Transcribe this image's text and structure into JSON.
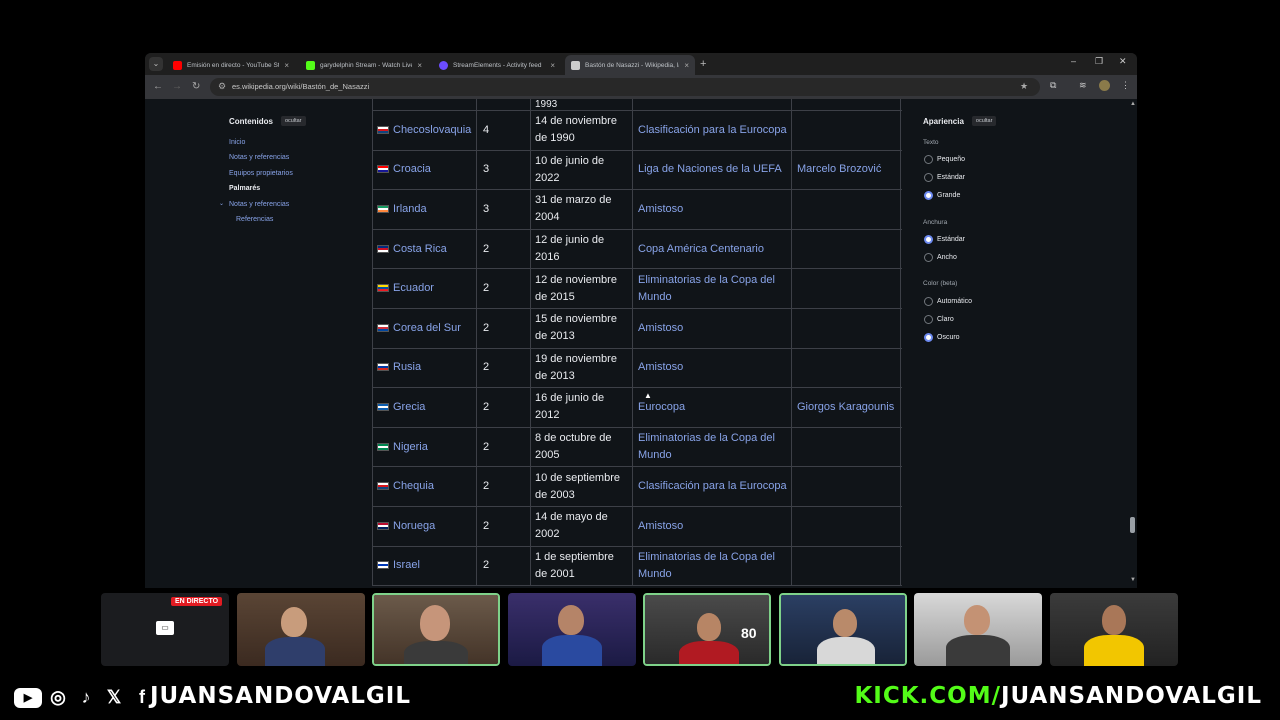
{
  "browser": {
    "tabs": [
      {
        "title": "Emisión en directo - YouTube Stu",
        "color": "#ff0000"
      },
      {
        "title": "garydelphin Stream - Watch Live o",
        "color": "#53fc18"
      },
      {
        "title": "StreamElements - Activity feed",
        "color": "#6b4cff"
      },
      {
        "title": "Bastón de Nasazzi - Wikipedia, la",
        "color": "#cccccc"
      }
    ],
    "new_tab": "+",
    "url": "es.wikipedia.org/wiki/Bastón_de_Nasazzi"
  },
  "toc": {
    "title": "Contenidos",
    "hide": "ocultar",
    "items": [
      "Inicio",
      "Notas y referencias",
      "Equipos propietarios",
      "Palmarés",
      "Notas y referencias",
      "Referencias"
    ]
  },
  "table": {
    "top_fragment": "1993",
    "rows": [
      {
        "country": "Checoslovaquia",
        "count": "4",
        "date": "14 de noviembre de 1990",
        "match": "Clasificación para la Eurocopa",
        "captain": "",
        "flag": [
          "#ffffff",
          "#d7141a",
          "#11457e"
        ]
      },
      {
        "country": "Croacia",
        "count": "3",
        "date": "10 de junio de 2022",
        "match": "Liga de Naciones de la UEFA",
        "captain": "Marcelo Brozović",
        "flag": [
          "#ff0000",
          "#ffffff",
          "#171796"
        ]
      },
      {
        "country": "Irlanda",
        "count": "3",
        "date": "31 de marzo de 2004",
        "match": "Amistoso",
        "captain": "",
        "flag": [
          "#169b62",
          "#ffffff",
          "#ff883e"
        ]
      },
      {
        "country": "Costa Rica",
        "count": "2",
        "date": "12 de junio de 2016",
        "match": "Copa América Centenario",
        "captain": "",
        "flag": [
          "#002b7f",
          "#ce1126",
          "#ffffff"
        ]
      },
      {
        "country": "Ecuador",
        "count": "2",
        "date": "12 de noviembre de 2015",
        "match": "Eliminatorias de la Copa del Mundo",
        "captain": "",
        "flag": [
          "#ffdd00",
          "#034ea2",
          "#ed1c24"
        ]
      },
      {
        "country": "Corea del Sur",
        "count": "2",
        "date": "15 de noviembre de 2013",
        "match": "Amistoso",
        "captain": "",
        "flag": [
          "#ffffff",
          "#cd2e3a",
          "#0047a0"
        ]
      },
      {
        "country": "Rusia",
        "count": "2",
        "date": "19 de noviembre de 2013",
        "match": "Amistoso",
        "captain": "",
        "flag": [
          "#ffffff",
          "#0039a6",
          "#d52b1e"
        ]
      },
      {
        "country": "Grecia",
        "count": "2",
        "date": "16 de junio de 2012",
        "match": "Eurocopa",
        "captain": "Giorgos Karagounis",
        "flag": [
          "#0d5eaf",
          "#ffffff",
          "#0d5eaf"
        ]
      },
      {
        "country": "Nigeria",
        "count": "2",
        "date": "8 de octubre de 2005",
        "match": "Eliminatorias de la Copa del Mundo",
        "captain": "",
        "flag": [
          "#008751",
          "#ffffff",
          "#008751"
        ]
      },
      {
        "country": "Chequia",
        "count": "2",
        "date": "10 de septiembre de 2003",
        "match": "Clasificación para la Eurocopa",
        "captain": "",
        "flag": [
          "#ffffff",
          "#d7141a",
          "#11457e"
        ]
      },
      {
        "country": "Noruega",
        "count": "2",
        "date": "14 de mayo de 2002",
        "match": "Amistoso",
        "captain": "",
        "flag": [
          "#ba0c2f",
          "#ffffff",
          "#00205b"
        ]
      },
      {
        "country": "Israel",
        "count": "2",
        "date": "1 de septiembre de 2001",
        "match": "Eliminatorias de la Copa del Mundo",
        "captain": "",
        "flag": [
          "#ffffff",
          "#0038b8",
          "#ffffff"
        ]
      }
    ]
  },
  "appearance": {
    "title": "Apariencia",
    "hide": "ocultar",
    "text_label": "Texto",
    "text_options": [
      "Pequeño",
      "Estándar",
      "Grande"
    ],
    "text_selected": "Grande",
    "width_label": "Anchura",
    "width_options": [
      "Estándar",
      "Ancho"
    ],
    "width_selected": "Estándar",
    "color_label": "Color (beta)",
    "color_options": [
      "Automático",
      "Claro",
      "Oscuro"
    ],
    "color_selected": "Oscuro"
  },
  "stream": {
    "live_badge": "EN DIRECTO",
    "handle": "JUANSANDOVALGIL",
    "kick_prefix": "KICK.COM/",
    "kick_handle": "JUANSANDOVALGIL",
    "jersey_number": "80"
  }
}
